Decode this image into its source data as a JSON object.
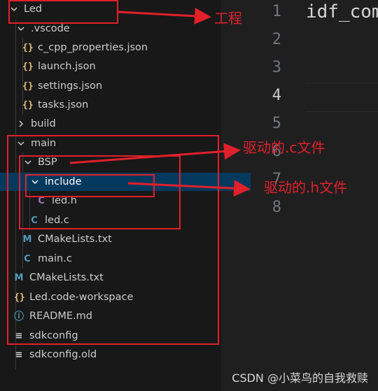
{
  "explorer": {
    "items": [
      {
        "label": "Led",
        "kind": "folder-open"
      },
      {
        "label": ".vscode",
        "kind": "folder-open"
      },
      {
        "label": "c_cpp_properties.json",
        "kind": "json",
        "icon": "{}"
      },
      {
        "label": "launch.json",
        "kind": "json",
        "icon": "{}"
      },
      {
        "label": "settings.json",
        "kind": "json",
        "icon": "{}"
      },
      {
        "label": "tasks.json",
        "kind": "json",
        "icon": "{}"
      },
      {
        "label": "build",
        "kind": "folder-closed"
      },
      {
        "label": "main",
        "kind": "folder-open"
      },
      {
        "label": "BSP",
        "kind": "folder-open"
      },
      {
        "label": "include",
        "kind": "folder-open",
        "selected": true
      },
      {
        "label": "led.h",
        "kind": "c-header",
        "icon": "C"
      },
      {
        "label": "led.c",
        "kind": "c-source",
        "icon": "C"
      },
      {
        "label": "CMakeLists.txt",
        "kind": "cmake",
        "icon": "M"
      },
      {
        "label": "main.c",
        "kind": "c-source",
        "icon": "C"
      },
      {
        "label": "CMakeLists.txt",
        "kind": "cmake",
        "icon": "M"
      },
      {
        "label": "Led.code-workspace",
        "kind": "json",
        "icon": "{}"
      },
      {
        "label": "README.md",
        "kind": "info",
        "icon": "ⓘ"
      },
      {
        "label": "sdkconfig",
        "kind": "config",
        "icon": "≡"
      },
      {
        "label": "sdkconfig.old",
        "kind": "config",
        "icon": "≡"
      }
    ]
  },
  "editor": {
    "line_numbers": [
      "1",
      "2",
      "3",
      "4",
      "5",
      "6",
      "7",
      "8"
    ],
    "active_line": "4",
    "code_line_1": "idf_com"
  },
  "annotations": {
    "project": "工程",
    "c_files": "驱动的.c文件",
    "h_files": "驱动的.h文件"
  },
  "watermark": "CSDN @小菜鸟的自我救赎",
  "colors": {
    "annotation_red": "#e0202b",
    "selection": "#04395e",
    "sidebar_bg": "#181818",
    "editor_bg": "#1f1f1f"
  }
}
